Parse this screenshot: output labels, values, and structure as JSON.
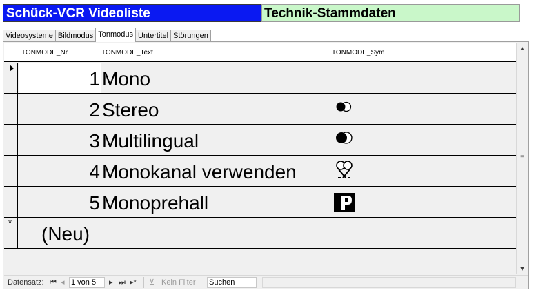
{
  "title": {
    "app": "Schück-VCR Videoliste",
    "section": "Technik-Stammdaten"
  },
  "tabs": [
    {
      "label": "Videosysteme"
    },
    {
      "label": "Bildmodus"
    },
    {
      "label": "Tonmodus",
      "active": true
    },
    {
      "label": "Untertitel"
    },
    {
      "label": "Störungen"
    }
  ],
  "table": {
    "columns": [
      "TONMODE_Nr",
      "TONMODE_Text",
      "TONMODE_Sym"
    ],
    "rows": [
      {
        "nr": "1",
        "text": "Mono",
        "sym": "none"
      },
      {
        "nr": "2",
        "text": "Stereo",
        "sym": "stereo-circles-icon"
      },
      {
        "nr": "3",
        "text": "Multilingual",
        "sym": "multilingual-circles-icon"
      },
      {
        "nr": "4",
        "text": "Monokanal verwenden",
        "sym": "monochannel-icon"
      },
      {
        "nr": "5",
        "text": "Monoprehall",
        "sym": "monoprehall-p-icon"
      }
    ],
    "new_row_label": "(Neu)",
    "selector_new": "*"
  },
  "navigation": {
    "label": "Datensatz:",
    "position": "1 von 5",
    "filter": "Kein Filter",
    "search": "Suchen"
  },
  "colors": {
    "title_bg": "#0a19f2",
    "section_bg": "#c9f7c9",
    "grid_bg": "#f0f0f0"
  }
}
